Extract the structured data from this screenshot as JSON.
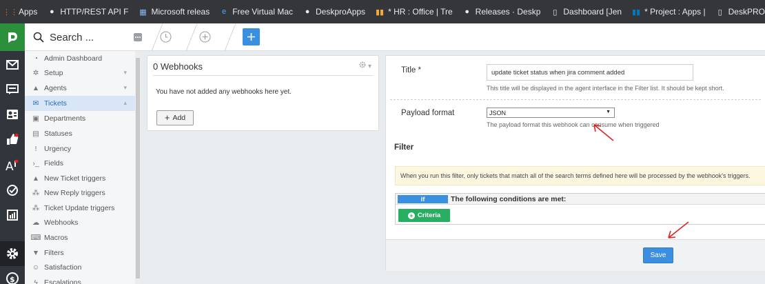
{
  "bookmarks": [
    {
      "label": "Apps",
      "icon": "apps-grid-icon",
      "color": "#e8710a"
    },
    {
      "label": "HTTP/REST API F",
      "icon": "bookmark-icon",
      "color": "#e8eaed"
    },
    {
      "label": "Microsoft releas",
      "icon": "microsoft-icon",
      "color": "#8ab4f8"
    },
    {
      "label": "Free Virtual Mac",
      "icon": "edge-icon",
      "color": "#4aa8ff"
    },
    {
      "label": "DeskproApps",
      "icon": "github-icon",
      "color": "#e8eaed"
    },
    {
      "label": "* HR : Office | Tre",
      "icon": "trello-icon",
      "color": "#f2a93b"
    },
    {
      "label": "Releases · Deskp",
      "icon": "github-icon",
      "color": "#e8eaed"
    },
    {
      "label": "Dashboard [Jen",
      "icon": "page-icon",
      "color": "#e8eaed"
    },
    {
      "label": "* Project : Apps |",
      "icon": "trello-icon",
      "color": "#0079bf"
    },
    {
      "label": "DeskPRO Builde",
      "icon": "page-icon",
      "color": "#e8eaed"
    }
  ],
  "header": {
    "search_label": "Search ..."
  },
  "subnav": {
    "items": [
      {
        "label": "Admin Dashboard",
        "icon": "dashboard-icon"
      },
      {
        "label": "Setup",
        "icon": "gear-icon",
        "chevron": "▾"
      },
      {
        "label": "Agents",
        "icon": "user-icon",
        "chevron": "▾"
      },
      {
        "label": "Tickets",
        "icon": "envelope-icon",
        "chevron": "▴",
        "selected": true
      },
      {
        "label": "Departments",
        "icon": "building-icon"
      },
      {
        "label": "Statuses",
        "icon": "list-icon"
      },
      {
        "label": "Urgency",
        "icon": "exclamation-icon"
      },
      {
        "label": "Fields",
        "icon": "terminal-icon"
      },
      {
        "label": "New Ticket triggers",
        "icon": "user-icon"
      },
      {
        "label": "New Reply triggers",
        "icon": "users-icon"
      },
      {
        "label": "Ticket Update triggers",
        "icon": "users-icon"
      },
      {
        "label": "Webhooks",
        "icon": "cloud-icon"
      },
      {
        "label": "Macros",
        "icon": "keyboard-icon"
      },
      {
        "label": "Filters",
        "icon": "filter-icon"
      },
      {
        "label": "Satisfaction",
        "icon": "smile-icon"
      },
      {
        "label": "Escalations",
        "icon": "bolt-icon"
      }
    ]
  },
  "webhooks_panel": {
    "title": "0 Webhooks",
    "empty_message": "You have not added any webhooks here yet.",
    "add_label": "Add"
  },
  "form": {
    "title_label": "Title *",
    "title_value": "update ticket status when jira comment added",
    "title_help": "This title will be displayed in the agent interface in the Filter list. It should be kept short.",
    "payload_label": "Payload format",
    "payload_value": "JSON",
    "payload_help": "The payload format this webhook can consume when triggered",
    "filter_title": "Filter",
    "filter_info": "When you run this filter, only tickets that match all of the search terms defined here will be processed by the webhook's triggers.",
    "if_label": "if",
    "conditions_label": "The following conditions are met:",
    "criteria_label": "Criteria",
    "save_label": "Save"
  },
  "colors": {
    "accent": "#3b8fe0",
    "success": "#27ae60",
    "rail": "#31353c",
    "rail_top": "#2b8f3c",
    "annotation": "#e0201b"
  }
}
